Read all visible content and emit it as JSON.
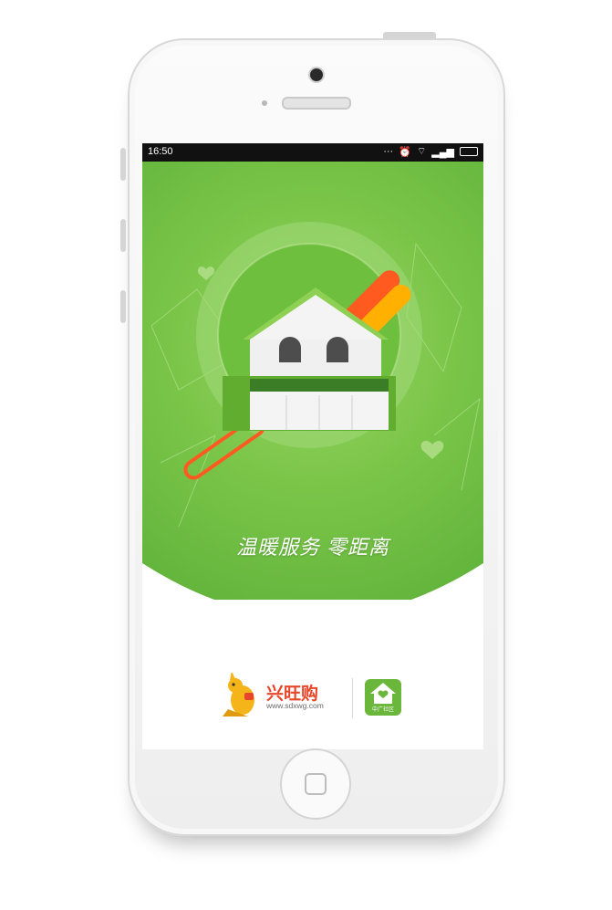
{
  "status_bar": {
    "time": "16:50"
  },
  "splash": {
    "slogan": "温暖服务 零距离"
  },
  "brands": {
    "primary_name": "兴旺购",
    "primary_url": "www.sdxwg.com",
    "secondary_caption": "中广社区"
  },
  "colors": {
    "green": "#7bc649",
    "accent_orange": "#ff5a1f",
    "accent_yellow": "#ffb000"
  }
}
